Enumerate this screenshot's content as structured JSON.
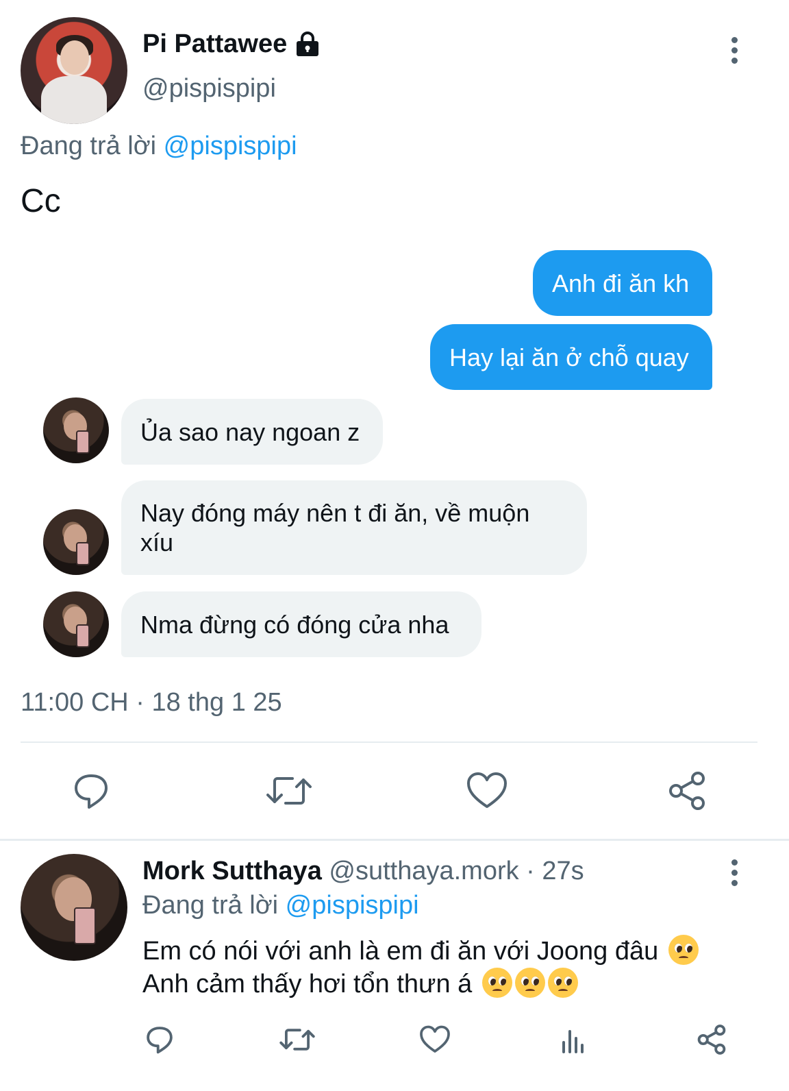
{
  "tweet": {
    "display_name": "Pi Pattawee",
    "handle": "@pispispipi",
    "replying_prefix": "Đang trả lời",
    "replying_to": "@pispispipi",
    "text": "Cc",
    "timestamp": "11:00 CH · 18 thg 1 25"
  },
  "chat": {
    "sent": [
      "Anh đi ăn kh",
      "Hay lại ăn ở chỗ quay"
    ],
    "received": [
      "Ủa sao nay ngoan z",
      "Nay đóng máy nên t đi ăn, về muộn",
      "xíu",
      "Nma đừng có đóng cửa nha"
    ],
    "sent_color": "#1d9bf0",
    "received_color": "#eff3f4"
  },
  "reply": {
    "display_name": "Mork Sutthaya",
    "handle_time": "@sutthaya.mork · 27s",
    "replying_prefix": "Đang trả lời",
    "replying_to": "@pispispipi",
    "line1": "Em có nói với anh là em đi ăn với Joong đâu",
    "line2": "Anh cảm thấy hơi tổn thưn á",
    "emoji": "pleading-face"
  },
  "colors": {
    "accent": "#1d9bf0",
    "secondary_text": "#536471",
    "primary_text": "#0f1419"
  }
}
